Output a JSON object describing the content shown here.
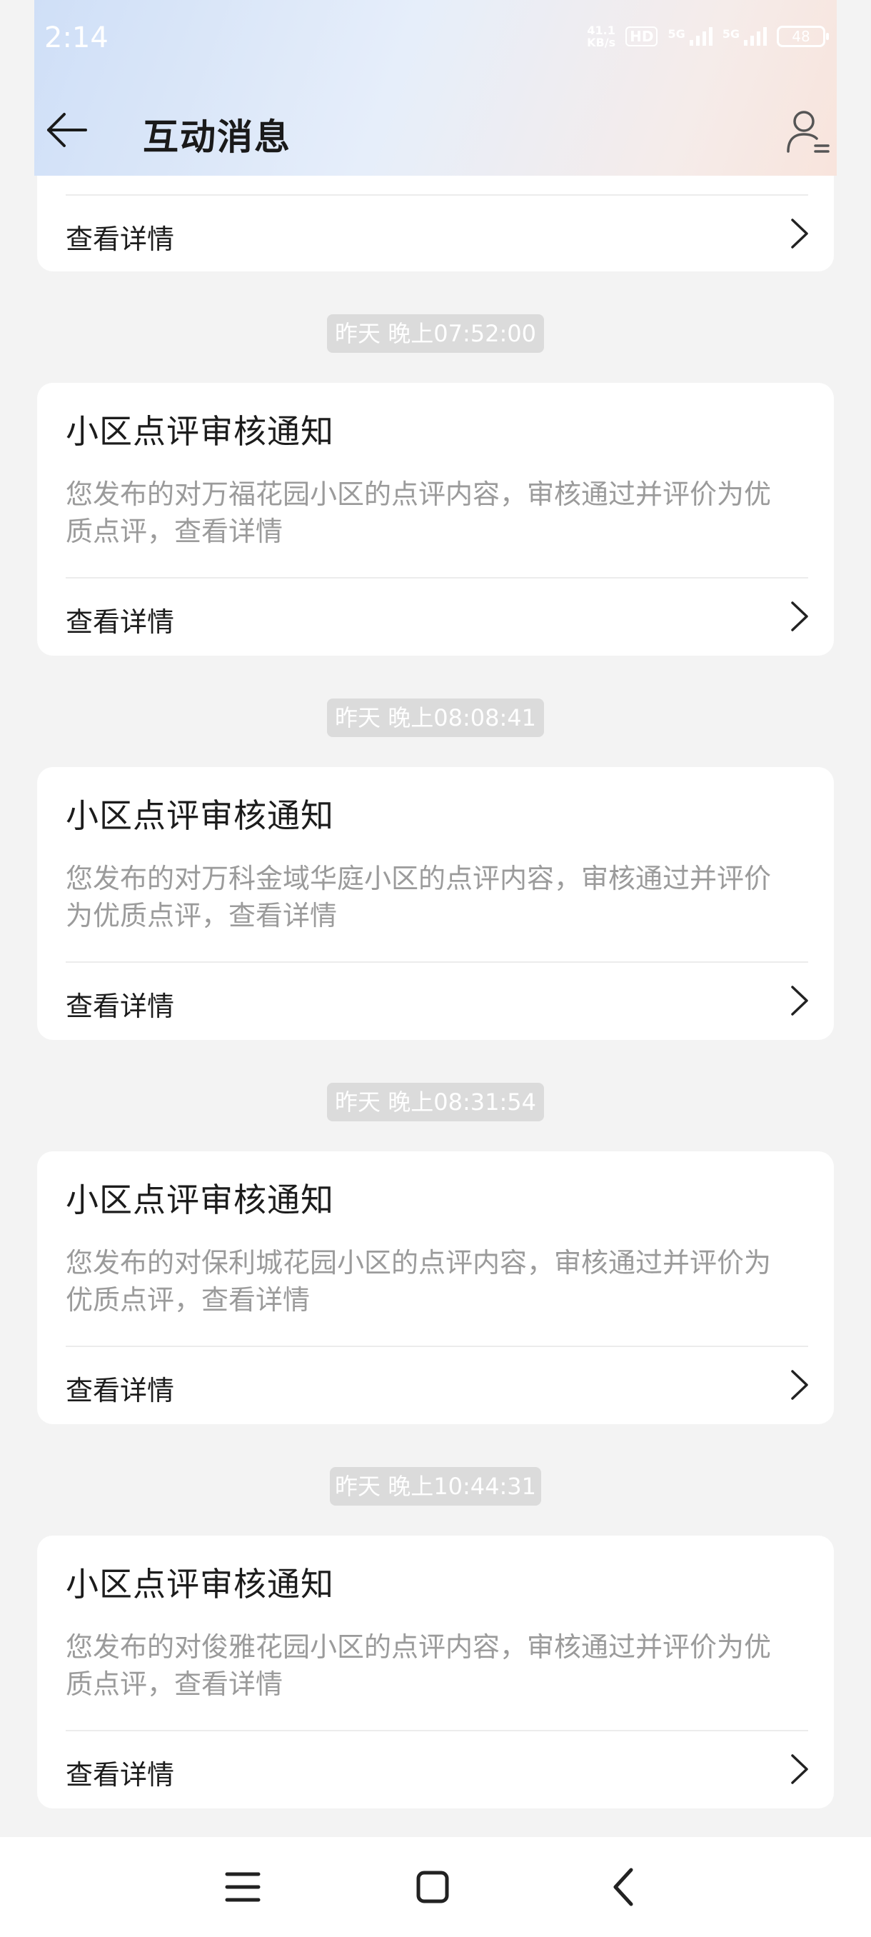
{
  "status_bar": {
    "time": "2:14",
    "net_speed_value": "41.1",
    "net_speed_unit": "KB/s",
    "hd_badge": "HD",
    "signal_1": "5G",
    "signal_2": "5G",
    "battery": "48"
  },
  "app_bar": {
    "title": "互动消息",
    "back_icon": "arrow-left-icon",
    "profile_icon": "user-settings-icon"
  },
  "messages": [
    {
      "detail_label": "查看详情"
    },
    {
      "timestamp": "昨天 晚上07:52:00",
      "title": "小区点评审核通知",
      "desc_line1": "您发布的对万福花园小区的点评内容，审核通过并评价为优",
      "desc_line2": "质点评，查看详情",
      "detail_label": "查看详情"
    },
    {
      "timestamp": "昨天 晚上08:08:41",
      "title": "小区点评审核通知",
      "desc_line1": "您发布的对万科金域华庭小区的点评内容，审核通过并评价",
      "desc_line2": "为优质点评，查看详情",
      "detail_label": "查看详情"
    },
    {
      "timestamp": "昨天 晚上08:31:54",
      "title": "小区点评审核通知",
      "desc_line1": "您发布的对保利城花园小区的点评内容，审核通过并评价为",
      "desc_line2": "优质点评，查看详情",
      "detail_label": "查看详情"
    },
    {
      "timestamp": "昨天 晚上10:44:31",
      "title": "小区点评审核通知",
      "desc_line1": "您发布的对俊雅花园小区的点评内容，审核通过并评价为优",
      "desc_line2": "质点评，查看详情",
      "detail_label": "查看详情"
    }
  ],
  "nav_bar": {
    "menu_icon": "menu-icon",
    "home_icon": "home-square-icon",
    "back_icon": "back-chevron-icon"
  },
  "colors": {
    "background": "#f3f3f3",
    "card": "#ffffff",
    "title_text": "#1c1c1c",
    "desc_text": "#9b9b9b",
    "timestamp_bg": "#dbdbdb"
  }
}
